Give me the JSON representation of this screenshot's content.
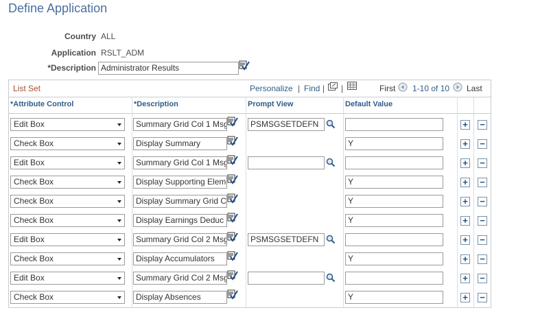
{
  "page": {
    "title": "Define Application"
  },
  "fields": {
    "country_label": "Country",
    "country_value": "ALL",
    "application_label": "Application",
    "application_value": "RSLT_ADM",
    "description_label": "*Description",
    "description_value": "Administrator Results"
  },
  "grid": {
    "title": "List Set",
    "personalize": "Personalize",
    "find": "Find",
    "pagination_first": "First",
    "pagination_range": "1-10 of 10",
    "pagination_last": "Last",
    "headers": {
      "attribute_control": "*Attribute Control",
      "description": "*Description",
      "prompt_view": "Prompt View",
      "default_value": "Default Value"
    },
    "rows": [
      {
        "control": "Edit Box",
        "description": "Summary Grid Col 1 Msg",
        "prompt": "PSMSGSETDEFN",
        "has_prompt": true,
        "default": ""
      },
      {
        "control": "Check Box",
        "description": "Display Summary",
        "prompt": "",
        "has_prompt": false,
        "default": "Y"
      },
      {
        "control": "Edit Box",
        "description": "Summary Grid Col 1 Msg",
        "prompt": "",
        "has_prompt": true,
        "default": ""
      },
      {
        "control": "Check Box",
        "description": "Display Supporting Elem",
        "prompt": "",
        "has_prompt": false,
        "default": "Y"
      },
      {
        "control": "Check Box",
        "description": "Display Summary Grid C",
        "prompt": "",
        "has_prompt": false,
        "default": "Y"
      },
      {
        "control": "Check Box",
        "description": "Display Earnings Deduc",
        "prompt": "",
        "has_prompt": false,
        "default": "Y"
      },
      {
        "control": "Edit Box",
        "description": "Summary Grid Col 2 Msg",
        "prompt": "PSMSGSETDEFN",
        "has_prompt": true,
        "default": ""
      },
      {
        "control": "Check Box",
        "description": "Display Accumulators",
        "prompt": "",
        "has_prompt": false,
        "default": "Y"
      },
      {
        "control": "Edit Box",
        "description": "Summary Grid Col 2 Msg",
        "prompt": "",
        "has_prompt": true,
        "default": ""
      },
      {
        "control": "Check Box",
        "description": "Display Absences",
        "prompt": "",
        "has_prompt": false,
        "default": "Y"
      }
    ]
  },
  "icons": {
    "spell_check": "spell-check-icon",
    "lookup": "lookup-magnifier-icon",
    "add": "add-row-icon",
    "delete": "delete-row-icon",
    "view_all": "view-all-icon",
    "download": "download-excel-icon",
    "prev": "previous-arrow-icon",
    "next": "next-arrow-icon"
  },
  "colors": {
    "title": "#4c6f9e",
    "grid_title": "#a5502c",
    "link": "#2d5c8a",
    "border": "#c6ccd3"
  }
}
